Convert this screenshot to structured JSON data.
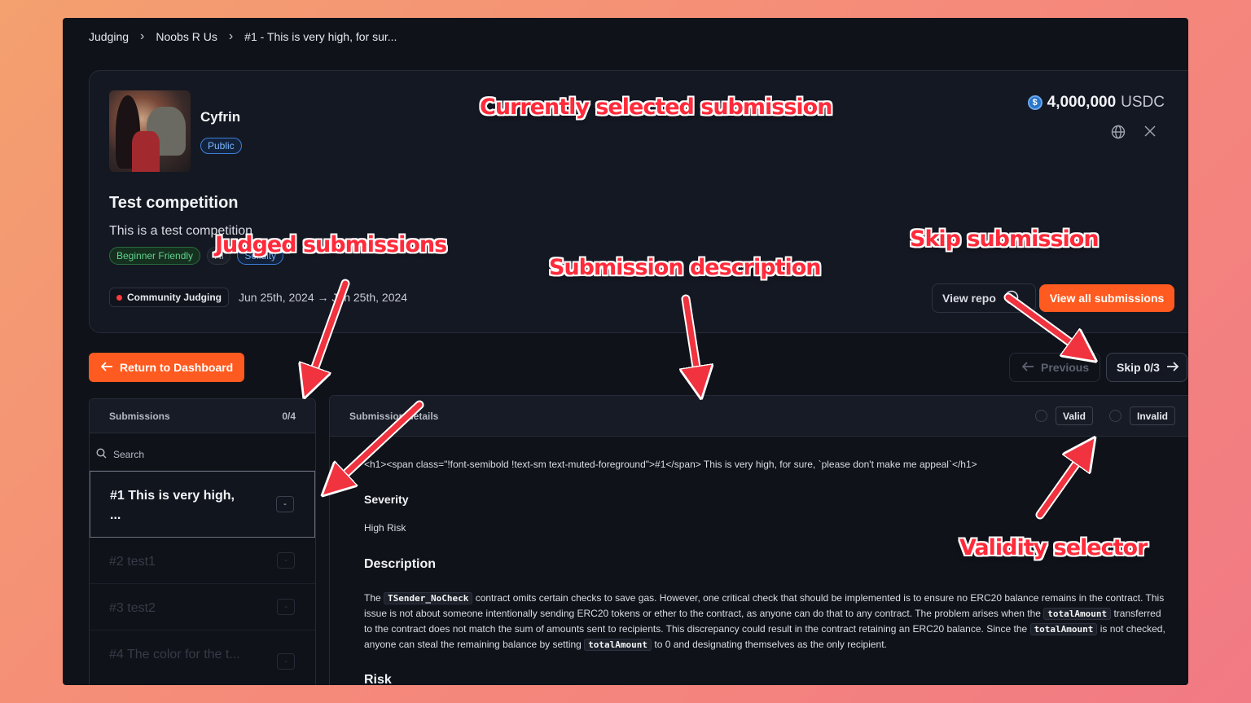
{
  "breadcrumb": [
    "Judging",
    "Noobs R Us",
    "#1 - This is very high, for sur..."
  ],
  "org": {
    "name": "Cyfrin",
    "visibility": "Public"
  },
  "prize": {
    "amount": "4,000,000",
    "currency": "USDC"
  },
  "competition": {
    "title": "Test competition",
    "description": "This is a test competition",
    "tags": [
      "Beginner Friendly",
      "Hi",
      "Solidity"
    ],
    "judging_label": "Community Judging",
    "dates": "Jun 25th, 2024 → Jun 25th, 2024"
  },
  "buttons": {
    "view_repo": "View repo",
    "view_all": "View all submissions",
    "return": "Return to Dashboard",
    "previous": "Previous",
    "skip": "Skip 0/3"
  },
  "sidebar": {
    "title": "Submissions",
    "count": "0/4",
    "search_placeholder": "Search",
    "items": [
      {
        "title": "#1 This is very high, ...",
        "status": "-"
      },
      {
        "title": "#2 test1",
        "status": "-"
      },
      {
        "title": "#3 test2",
        "status": "-"
      },
      {
        "title": "#4 The color for the t...",
        "status": "-"
      }
    ]
  },
  "detail": {
    "title": "Submission details",
    "valid": "Valid",
    "invalid": "Invalid",
    "raw_line": "<h1><span class=\"!font-semibold !text-sm text-muted-foreground\">#1</span> This is very high, for sure, `please don't make me appeal`</h1>",
    "severity_heading": "Severity",
    "severity_value": "High Risk",
    "description_heading": "Description",
    "desc": {
      "p1": "The ",
      "code1": "TSender_NoCheck",
      "p2": " contract omits certain checks to save gas. However, one critical check that should be implemented is to ensure no ERC20 balance remains in the contract. This issue is not about someone intentionally sending ERC20 tokens or ether to the contract, as anyone can do that to any contract. The problem arises when the ",
      "code2": "totalAmount",
      "p3": " transferred to the contract does not match the sum of amounts sent to recipients. This discrepancy could result in the contract retaining an ERC20 balance. Since the ",
      "code3": "totalAmount",
      "p4": " is not checked, anyone can steal the remaining balance by setting ",
      "code4": "totalAmount",
      "p5": " to 0 and designating themselves as the only recipient."
    },
    "risk_heading": "Risk"
  },
  "annotations": {
    "selected": "Currently selected submission",
    "judged": "Judged submissions",
    "description": "Submission description",
    "skip": "Skip submission",
    "validity": "Validity selector"
  },
  "colors": {
    "accent": "#ff5a1f",
    "annotation": "#ff2a3a",
    "background": "#0f1219"
  }
}
